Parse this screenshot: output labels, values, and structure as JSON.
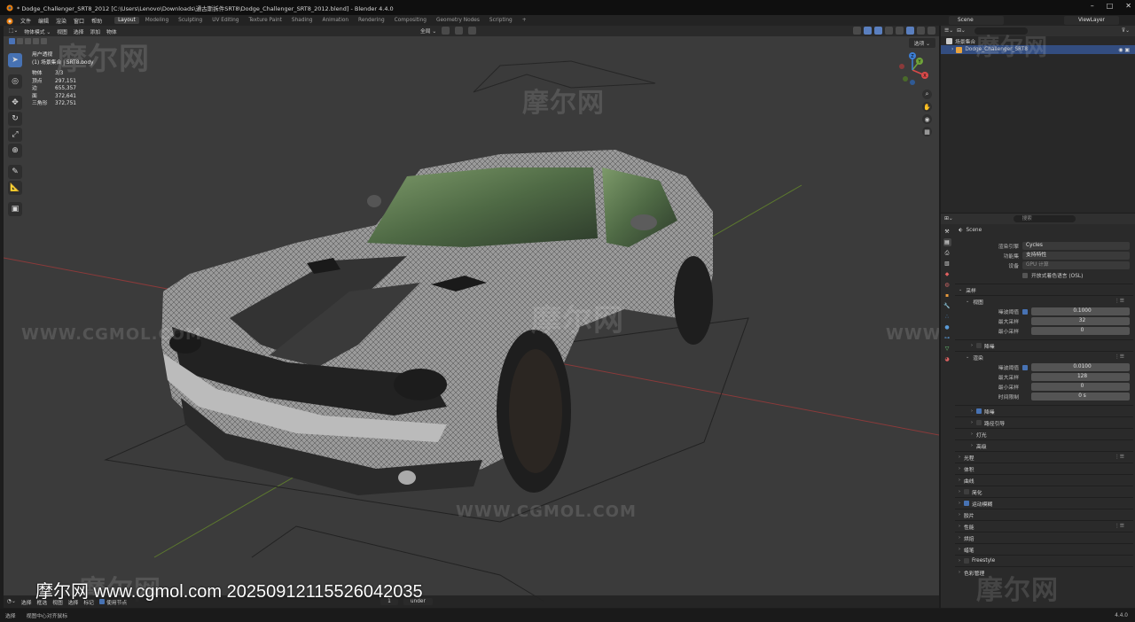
{
  "window": {
    "title": "* Dodge_Challenger_SRT8_2012 [C:\\Users\\Lenovo\\Downloads\\通古斯拆件SRT8\\Dodge_Challenger_SRT8_2012.blend] - Blender 4.4.0",
    "controls": [
      "–",
      "□",
      "✕"
    ]
  },
  "menu": {
    "items": [
      "文件",
      "编辑",
      "渲染",
      "窗口",
      "帮助"
    ],
    "workspaces": [
      "Layout",
      "Modeling",
      "Sculpting",
      "UV Editing",
      "Texture Paint",
      "Shading",
      "Animation",
      "Rendering",
      "Compositing",
      "Geometry Nodes",
      "Scripting",
      "+"
    ],
    "active_workspace": "Layout",
    "scene": "Scene",
    "view_layer": "ViewLayer"
  },
  "viewport": {
    "header": [
      "物体模式 ⌄",
      "视图",
      "选择",
      "添加",
      "物体"
    ],
    "transform": "全局 ⌄",
    "select_mode": "选项 ⌄",
    "stats": {
      "view": "用户透视",
      "collection": "(1) 场景集合 | SRT8.body",
      "rows": [
        {
          "k": "物体",
          "v": "3/3"
        },
        {
          "k": "顶点",
          "v": "297,151"
        },
        {
          "k": "边",
          "v": "655,357"
        },
        {
          "k": "面",
          "v": "372,641"
        },
        {
          "k": "三角形",
          "v": "372,751"
        }
      ]
    },
    "footer": {
      "items": [
        "选择",
        "框选",
        "视图",
        "选择",
        "标记"
      ],
      "checkbox_label": "使用节点",
      "frame": "1",
      "layer": "under"
    },
    "gizmo_axes": [
      "X",
      "Y",
      "Z"
    ]
  },
  "outliner": {
    "rows": [
      {
        "label": "场景集合",
        "icon": "collection-icon"
      },
      {
        "label": "Dodge_Challenger_SRT8",
        "icon": "object-icon",
        "selected": true
      }
    ]
  },
  "properties": {
    "search_placeholder": "搜索",
    "breadcrumb": "Scene",
    "engine_label": "渲染引擎",
    "engine_value": "Cycles",
    "featureset_label": "功能集",
    "featureset_value": "支持特性",
    "device_label": "设备",
    "device_value": "GPU 计算",
    "osl_label": "开放式着色语言 (OSL)",
    "sampling": {
      "title": "采样",
      "viewport_title": "视图",
      "viewport_fields": [
        {
          "label": "噪波阈值",
          "value": "0.1000",
          "check": true
        },
        {
          "label": "最大采样",
          "value": "32"
        },
        {
          "label": "最小采样",
          "value": "0"
        }
      ],
      "denoise_viewport": "降噪",
      "render_title": "渲染",
      "render_fields": [
        {
          "label": "噪波阈值",
          "value": "0.0100",
          "check": true
        },
        {
          "label": "最大采样",
          "value": "128"
        },
        {
          "label": "最小采样",
          "value": "0"
        },
        {
          "label": "时间限制",
          "value": "0 s"
        }
      ],
      "sub": [
        "降噪",
        "路径引导",
        "灯光",
        "高级"
      ]
    },
    "sections": [
      "光程",
      "体积",
      "曲线",
      "简化",
      "运动模糊",
      "胶片",
      "性能",
      "烘焙",
      "蜡笔",
      "Freestyle",
      "色彩管理"
    ]
  },
  "status": {
    "left": [
      "选择",
      "视图中心对齐鼠标"
    ],
    "version": "4.4.0"
  },
  "watermarks": {
    "cn": "摩尔网",
    "en": "WWW.CGMOL.COM"
  },
  "stamp": "摩尔网 www.cgmol.com 20250912115526042035",
  "colors": {
    "accent": "#4772b3",
    "viewport_bg": "#3b3b3b",
    "panel_bg": "#2a2a2a"
  }
}
